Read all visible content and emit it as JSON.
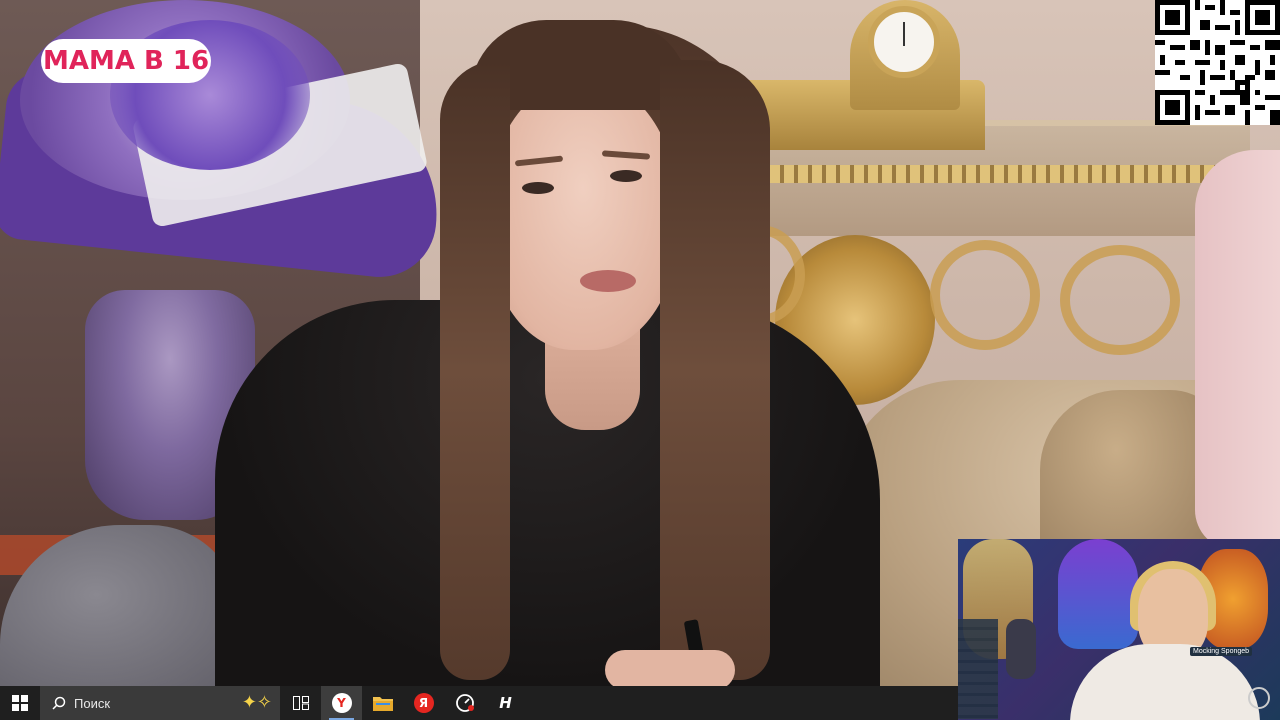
{
  "video": {
    "logo_text": "МАМА В 16"
  },
  "webcam": {
    "badge_text": "Mocking Spongeb"
  },
  "taskbar": {
    "search_placeholder": "Поиск",
    "apps": [
      {
        "name": "task-view",
        "icon": "task-view-icon"
      },
      {
        "name": "yandex-browser",
        "icon": "yandex-browser-icon",
        "active": true
      },
      {
        "name": "file-explorer",
        "icon": "folder-icon"
      },
      {
        "name": "yandex",
        "icon": "yandex-icon"
      },
      {
        "name": "gauge-app",
        "icon": "gauge-icon"
      },
      {
        "name": "h-app",
        "icon": "h-app-icon"
      }
    ]
  },
  "colors": {
    "taskbar_bg": "#1f1f1f",
    "search_bg": "#3a3a3a",
    "logo_text": "#e0245a",
    "active_indicator": "#7aa7e0"
  }
}
